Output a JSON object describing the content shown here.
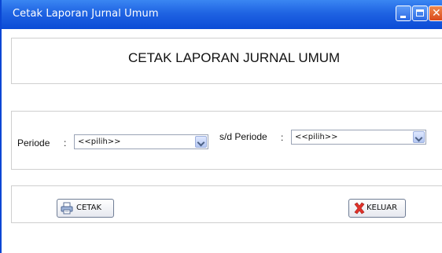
{
  "window": {
    "title": "Cetak Laporan Jurnal Umum",
    "controls": {
      "minimize": "minimize-icon",
      "maximize": "maximize-icon",
      "close": "close-icon"
    }
  },
  "header": {
    "heading": "CETAK LAPORAN JURNAL UMUM"
  },
  "form": {
    "periode_label": "Periode",
    "periode_colon": ":",
    "periode_value": "<<pilih>>",
    "sd_periode_label": "s/d Periode",
    "sd_periode_colon": ":",
    "sd_periode_value": "<<pilih>>"
  },
  "actions": {
    "cetak_label": "CETAK",
    "keluar_label": "KELUAR",
    "cetak_icon": "printer-icon",
    "keluar_icon": "red-x-icon"
  },
  "colors": {
    "titlebar": "#1f63e2",
    "close_button": "#d9491c"
  }
}
